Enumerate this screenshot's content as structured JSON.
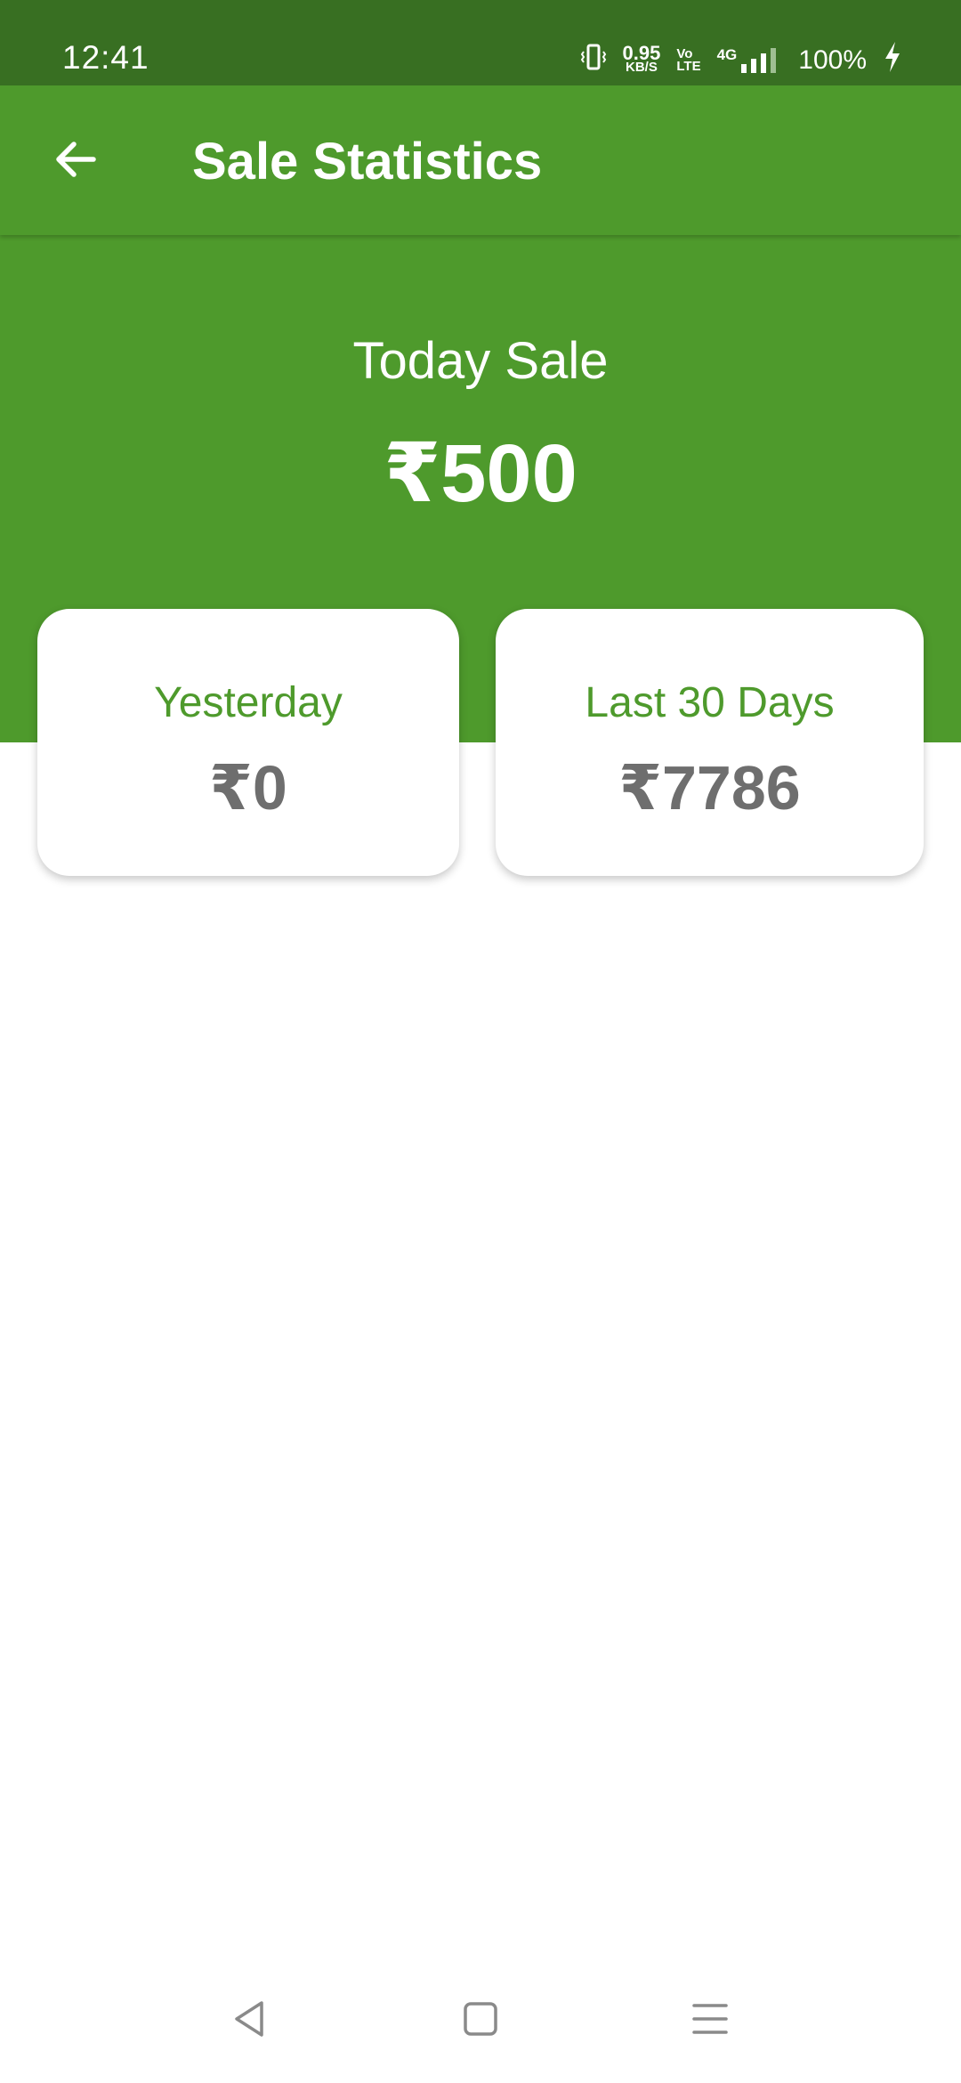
{
  "status_bar": {
    "time": "12:41",
    "net_speed_value": "0.95",
    "net_speed_unit": "KB/S",
    "volte_top": "Vo",
    "volte_bottom": "LTE",
    "network": "4G",
    "battery": "100%",
    "icons": [
      "vibrate-icon",
      "signal-icon",
      "charging-icon"
    ]
  },
  "app_bar": {
    "title": "Sale Statistics",
    "back_icon": "arrow-back-icon"
  },
  "today": {
    "label": "Today Sale",
    "value": "₹500"
  },
  "cards": [
    {
      "label": "Yesterday",
      "value": "₹0"
    },
    {
      "label": "Last 30 Days",
      "value": "₹7786"
    }
  ],
  "nav_bar": {
    "icons": [
      "back-triangle-icon",
      "home-square-icon",
      "menu-lines-icon"
    ]
  },
  "colors": {
    "status_bar": "#386f22",
    "primary": "#4e9a2c",
    "card_value": "#6e6e6e"
  }
}
